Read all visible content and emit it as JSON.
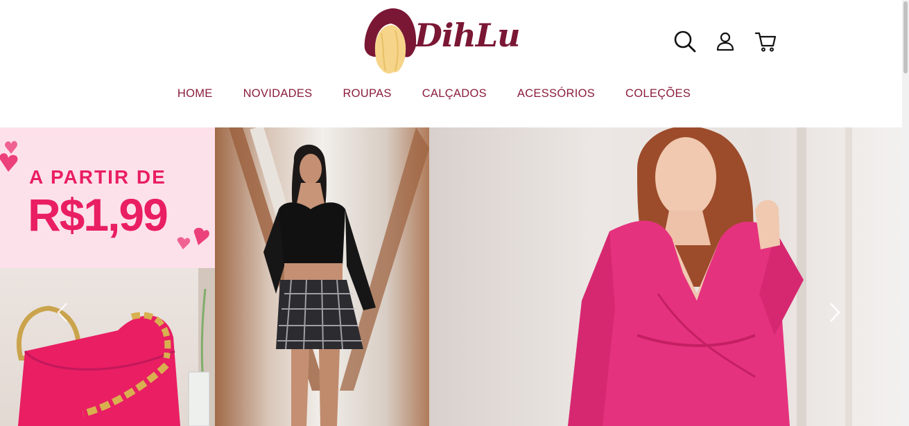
{
  "brand": {
    "name": "DihLu",
    "color": "#7a1734"
  },
  "header_icons": [
    "search-icon",
    "user-icon",
    "cart-icon"
  ],
  "nav": {
    "items": [
      {
        "label": "HOME"
      },
      {
        "label": "NOVIDADES"
      },
      {
        "label": "ROUPAS"
      },
      {
        "label": "CALÇADOS"
      },
      {
        "label": "ACESSÓRIOS"
      },
      {
        "label": "COLEÇÕES"
      }
    ],
    "color": "#8a1c3d"
  },
  "banner": {
    "promo_line1": "A PARTIR DE",
    "promo_line2": "R$1,99",
    "promo_color": "#e91e63",
    "promo_bg": "#fde1ea"
  },
  "carousel": {
    "prev_icon": "chevron-left-icon",
    "next_icon": "chevron-right-icon"
  }
}
